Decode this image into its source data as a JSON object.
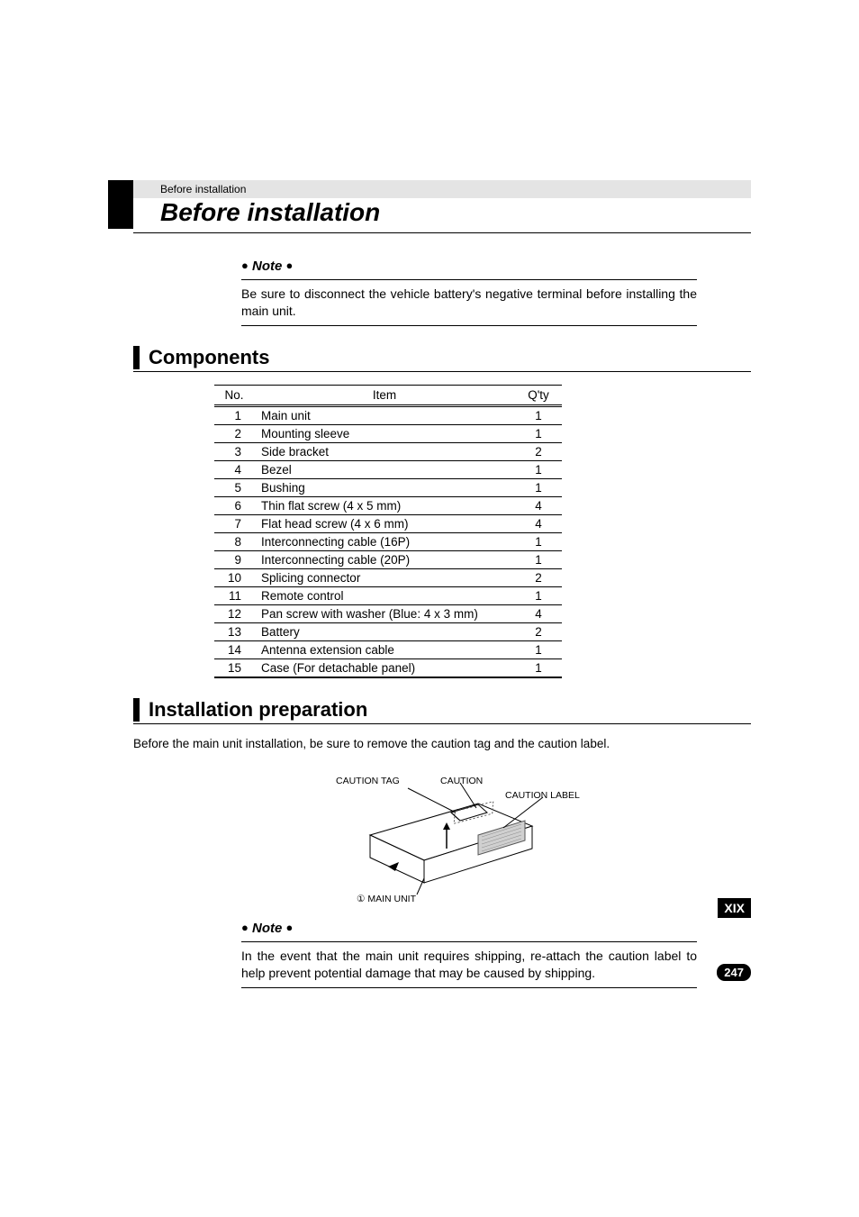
{
  "breadcrumb": "Before installation",
  "page_title": "Before installation",
  "note1": {
    "label": "Note",
    "body": "Be sure to disconnect the vehicle battery's negative terminal before installing the main unit."
  },
  "section_components": "Components",
  "components_table": {
    "headers": {
      "no": "No.",
      "item": "Item",
      "qty": "Q'ty"
    },
    "rows": [
      {
        "no": "1",
        "item": "Main unit",
        "qty": "1"
      },
      {
        "no": "2",
        "item": "Mounting sleeve",
        "qty": "1"
      },
      {
        "no": "3",
        "item": "Side bracket",
        "qty": "2"
      },
      {
        "no": "4",
        "item": "Bezel",
        "qty": "1"
      },
      {
        "no": "5",
        "item": "Bushing",
        "qty": "1"
      },
      {
        "no": "6",
        "item": "Thin flat screw (4 x 5 mm)",
        "qty": "4"
      },
      {
        "no": "7",
        "item": "Flat head screw (4 x 6 mm)",
        "qty": "4"
      },
      {
        "no": "8",
        "item": "Interconnecting cable (16P)",
        "qty": "1"
      },
      {
        "no": "9",
        "item": "Interconnecting cable (20P)",
        "qty": "1"
      },
      {
        "no": "10",
        "item": "Splicing connector",
        "qty": "2"
      },
      {
        "no": "11",
        "item": "Remote control",
        "qty": "1"
      },
      {
        "no": "12",
        "item": "Pan screw with washer (Blue: 4 x 3 mm)",
        "qty": "4"
      },
      {
        "no": "13",
        "item": "Battery",
        "qty": "2"
      },
      {
        "no": "14",
        "item": "Antenna extension cable",
        "qty": "1"
      },
      {
        "no": "15",
        "item": "Case (For detachable panel)",
        "qty": "1"
      }
    ]
  },
  "section_prep": "Installation preparation",
  "prep_text": "Before the main unit installation, be sure to remove the caution tag and the caution label.",
  "diagram": {
    "caution_tag": "CAUTION TAG",
    "caution": "CAUTION",
    "caution_label": "CAUTION LABEL",
    "main_unit": "MAIN UNIT",
    "circled_one": "①"
  },
  "note2": {
    "label": "Note",
    "body": "In the event that the main unit requires shipping, re-attach the caution label to help prevent potential damage that may be caused by shipping."
  },
  "side_badge": "XIX",
  "page_number": "247"
}
